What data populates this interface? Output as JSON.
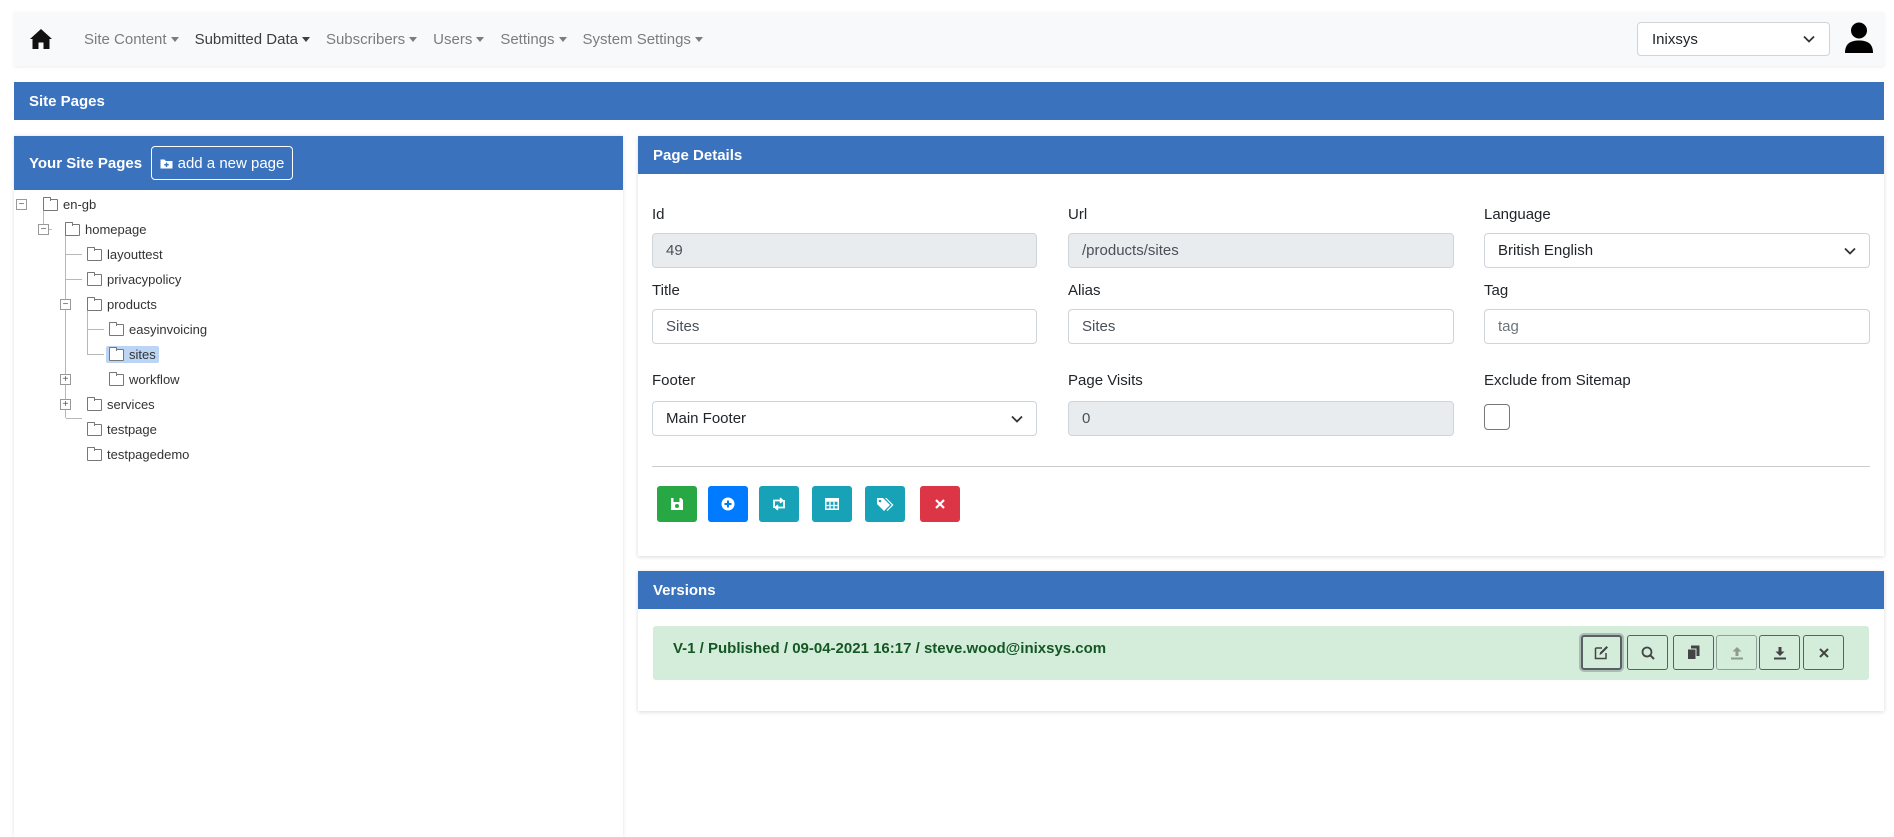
{
  "navbar": {
    "items": [
      {
        "label": "Site Content",
        "active": false
      },
      {
        "label": "Submitted Data",
        "active": true
      },
      {
        "label": "Subscribers",
        "active": false
      },
      {
        "label": "Users",
        "active": false
      },
      {
        "label": "Settings",
        "active": false
      },
      {
        "label": "System Settings",
        "active": false
      }
    ],
    "site_select_value": "Inixsys"
  },
  "site_pages": {
    "title": "Site Pages"
  },
  "tree_panel": {
    "title": "Your Site Pages",
    "add_button_label": "add a new page",
    "nodes": [
      {
        "label": "en-gb",
        "toggle": "−",
        "selected": false
      },
      {
        "label": "homepage",
        "toggle": "−",
        "selected": false
      },
      {
        "label": "layouttest",
        "toggle": "",
        "selected": false
      },
      {
        "label": "privacypolicy",
        "toggle": "",
        "selected": false
      },
      {
        "label": "products",
        "toggle": "−",
        "selected": false
      },
      {
        "label": "easyinvoicing",
        "toggle": "",
        "selected": false
      },
      {
        "label": "sites",
        "toggle": "",
        "selected": true
      },
      {
        "label": "workflow",
        "toggle": "",
        "selected": false
      },
      {
        "label": "services",
        "toggle": "+",
        "selected": false
      },
      {
        "label": "testpage",
        "toggle": "+",
        "selected": false
      },
      {
        "label": "testpagedemo",
        "toggle": "",
        "selected": false
      }
    ]
  },
  "details": {
    "title": "Page Details",
    "fields": {
      "id": {
        "label": "Id",
        "value": "49"
      },
      "url": {
        "label": "Url",
        "value": "/products/sites"
      },
      "language": {
        "label": "Language",
        "value": "British English"
      },
      "title": {
        "label": "Title",
        "value": "Sites"
      },
      "alias": {
        "label": "Alias",
        "value": "Sites"
      },
      "tag": {
        "label": "Tag",
        "placeholder": "tag"
      },
      "footer": {
        "label": "Footer",
        "value": "Main Footer"
      },
      "page_visits": {
        "label": "Page Visits",
        "value": "0"
      },
      "exclude_sitemap": {
        "label": "Exclude from Sitemap",
        "checked": false
      }
    },
    "actions": [
      "save",
      "add",
      "swap",
      "table",
      "tags",
      "delete"
    ]
  },
  "versions": {
    "title": "Versions",
    "rows": [
      {
        "text": "V-1 / Published / 09-04-2021 16:17 / steve.wood@inixsys.com"
      }
    ]
  },
  "colors": {
    "header_blue": "#3b72bd",
    "success_green": "#28a745",
    "primary_blue": "#007bff",
    "info_teal": "#17a2b8",
    "danger_red": "#dc3545",
    "version_bg": "#d4edda"
  }
}
